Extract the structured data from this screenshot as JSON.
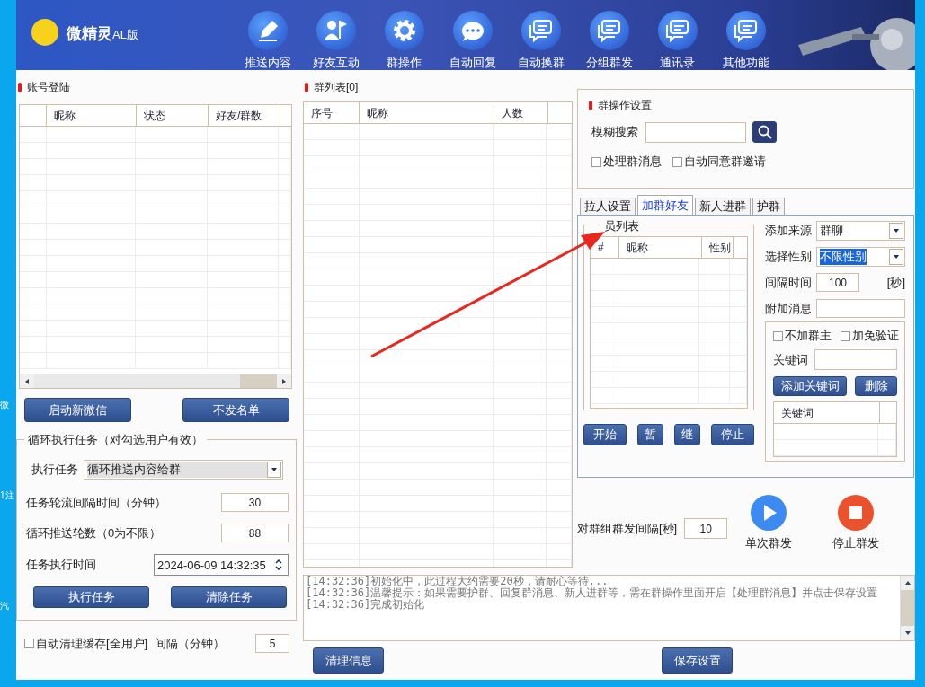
{
  "desktop_labels": [
    "微",
    "1注",
    "汽"
  ],
  "header": {
    "app_title": "微精灵",
    "app_edition": "AL版",
    "nav": [
      {
        "label": "推送内容",
        "kind": "pen"
      },
      {
        "label": "好友互动",
        "kind": "person"
      },
      {
        "label": "群操作",
        "kind": "gear"
      },
      {
        "label": "自动回复",
        "kind": "chat"
      },
      {
        "label": "自动换群",
        "kind": "stack"
      },
      {
        "label": "分组群发",
        "kind": "stack"
      },
      {
        "label": "通讯录",
        "kind": "stack"
      },
      {
        "label": "其他功能",
        "kind": "stack"
      }
    ]
  },
  "accounts": {
    "title": "账号登陆",
    "columns": [
      "昵称",
      "状态",
      "好友/群数"
    ]
  },
  "account_buttons": [
    "启动新微信",
    "不发名单"
  ],
  "loop_task": {
    "title": "循环执行任务（对勾选用户有效）",
    "task_label": "执行任务",
    "task_value": "循环推送内容给群",
    "fields": [
      {
        "label": "任务轮流间隔时间（分钟）",
        "value": "30",
        "kind": "number"
      },
      {
        "label": "循环推送轮数（0为不限）",
        "value": "88",
        "kind": "number"
      },
      {
        "label": "任务执行时间",
        "value": "2024-06-09 14:32:35",
        "kind": "datetime"
      }
    ],
    "buttons": [
      "执行任务",
      "清除任务"
    ]
  },
  "auto_clear": {
    "label": "自动清理缓存[全用户]",
    "checked": false,
    "interval_label": "间隔（分钟）",
    "interval": "5"
  },
  "groups": {
    "title": "群列表[0]",
    "columns": [
      "序号",
      "昵称",
      "人数"
    ]
  },
  "group_settings": {
    "title": "群操作设置",
    "search_label": "模糊搜索",
    "checkboxes": [
      {
        "label": "处理群消息",
        "checked": false
      },
      {
        "label": "自动同意群邀请",
        "checked": false
      }
    ]
  },
  "tabs": [
    {
      "label": "拉人设置",
      "selected": false
    },
    {
      "label": "加群好友",
      "selected": true
    },
    {
      "label": "新人进群",
      "selected": false
    },
    {
      "label": "护群",
      "selected": false
    }
  ],
  "add_friends": {
    "member_list_title": "员列表",
    "member_columns": [
      "#",
      "昵称",
      "性别"
    ],
    "source_label": "添加来源",
    "source": "群聊",
    "gender_label": "选择性别",
    "gender": "不限性别",
    "interval_label": "间隔时间",
    "interval": "100",
    "interval_unit": "[秒]",
    "message_label": "附加消息",
    "options": [
      {
        "label": "不加群主",
        "checked": false
      },
      {
        "label": "加免验证",
        "checked": false
      }
    ],
    "keyword_label": "关键词",
    "keyword_buttons": [
      "添加关键词",
      "删除"
    ],
    "keyword_column": "关键词",
    "controls": [
      "开始",
      "暂",
      "继",
      "停止"
    ]
  },
  "broadcast": {
    "interval_label": "对群组群发间隔[秒]",
    "interval": "10",
    "actions": [
      {
        "label": "单次群发",
        "kind": "play"
      },
      {
        "label": "停止群发",
        "kind": "stop"
      }
    ]
  },
  "log": [
    "[14:32:36]初始化中，此过程大约需要20秒，请耐心等待...",
    "[14:32:36]温馨提示：如果需要护群、回复群消息、新人进群等，需在群操作里面开启【处理群消息】并点击保存设置",
    "[14:32:36]完成初始化"
  ],
  "bottom_buttons": [
    "清理信息",
    "保存设置"
  ]
}
